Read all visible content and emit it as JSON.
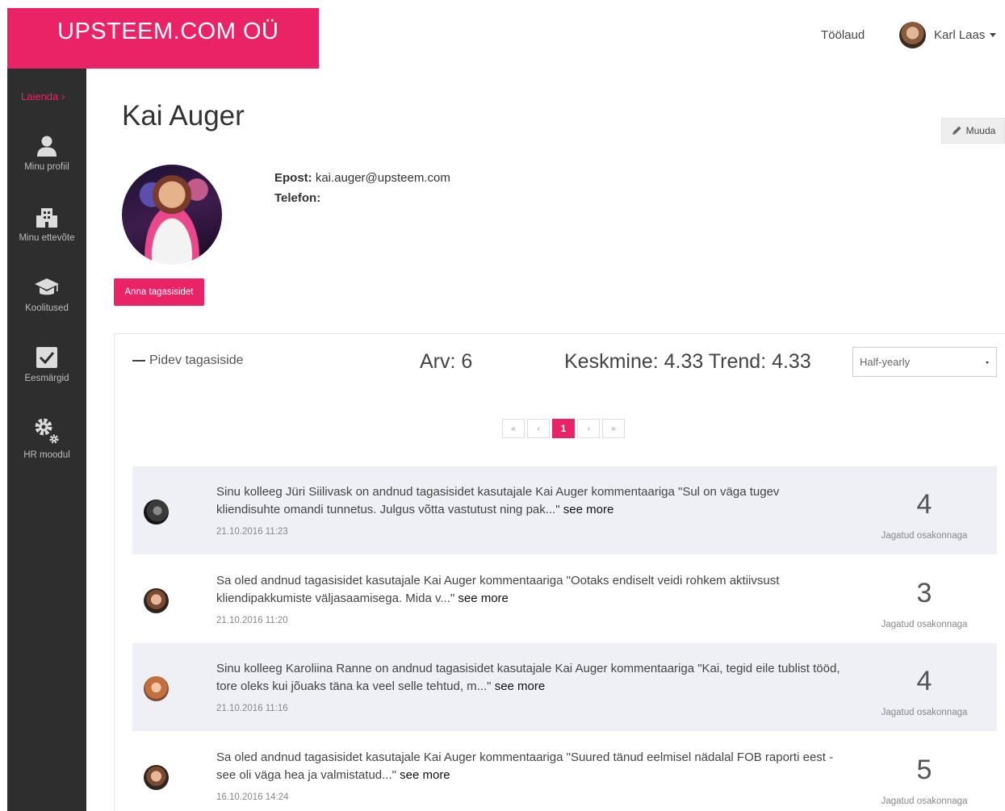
{
  "brand": {
    "name": "UPSTEEM.COM OÜ"
  },
  "topnav": {
    "dashboard_link": "Töölaud",
    "user_name": "Karl Laas"
  },
  "sidebar": {
    "expand_label": "Laienda",
    "items": [
      {
        "label": "Minu profiil",
        "icon": "user-icon"
      },
      {
        "label": "Minu ettevõte",
        "icon": "building-icon"
      },
      {
        "label": "Koolitused",
        "icon": "graduation-cap-icon"
      },
      {
        "label": "Eesmärgid",
        "icon": "checkbox-icon"
      },
      {
        "label": "HR moodul",
        "icon": "gears-icon"
      }
    ]
  },
  "profile": {
    "name": "Kai Auger",
    "edit_label": "Muuda",
    "email_label": "Epost:",
    "email": "kai.auger@upsteem.com",
    "phone_label": "Telefon:",
    "phone": "",
    "give_feedback_label": "Anna tagasisidet"
  },
  "feedback_panel": {
    "title": "Pidev tagasiside",
    "count_text": "Arv: 6",
    "stats_text": "Keskmine: 4.33 Trend: 4.33",
    "period": "Half-yearly",
    "pagination": {
      "first": "«",
      "prev": "‹",
      "current": "1",
      "next": "›",
      "last": "»"
    },
    "items": [
      {
        "text": "Sinu kolleeg Jüri Siilivask on andnud tagasisidet kasutajale Kai Auger kommentaariga \"Sul on väga tugev kliendisuhte omandi tunnetus. Julgus võtta vastutust ning pak...\"",
        "more": "see more",
        "date": "21.10.2016 11:23",
        "score": "4",
        "shared": "Jagatud osakonnaga"
      },
      {
        "text": "Sa oled andnud tagasisidet kasutajale Kai Auger kommentaariga \"Ootaks endiselt veidi rohkem aktiivsust kliendipakkumiste väljasaamisega. Mida v...\"",
        "more": "see more",
        "date": "21.10.2016 11:20",
        "score": "3",
        "shared": "Jagatud osakonnaga"
      },
      {
        "text": "Sinu kolleeg Karoliina Ranne on andnud tagasisidet kasutajale Kai Auger kommentaariga \"Kai, tegid eile tublist tööd, tore oleks kui jõuaks täna ka veel selle tehtud, m...\"",
        "more": "see more",
        "date": "21.10.2016 11:16",
        "score": "4",
        "shared": "Jagatud osakonnaga"
      },
      {
        "text": "Sa oled andnud tagasisidet kasutajale Kai Auger kommentaariga \"Suured tänud eelmisel nädalal FOB raporti eest - see oli väga hea ja valmistatud...\"",
        "more": "see more",
        "date": "16.10.2016 14:24",
        "score": "5",
        "shared": "Jagatud osakonnaga"
      }
    ]
  },
  "colors": {
    "accent": "#ea2366",
    "sidebar_bg": "#2e2e2e",
    "row_shade": "#eef0f6"
  }
}
